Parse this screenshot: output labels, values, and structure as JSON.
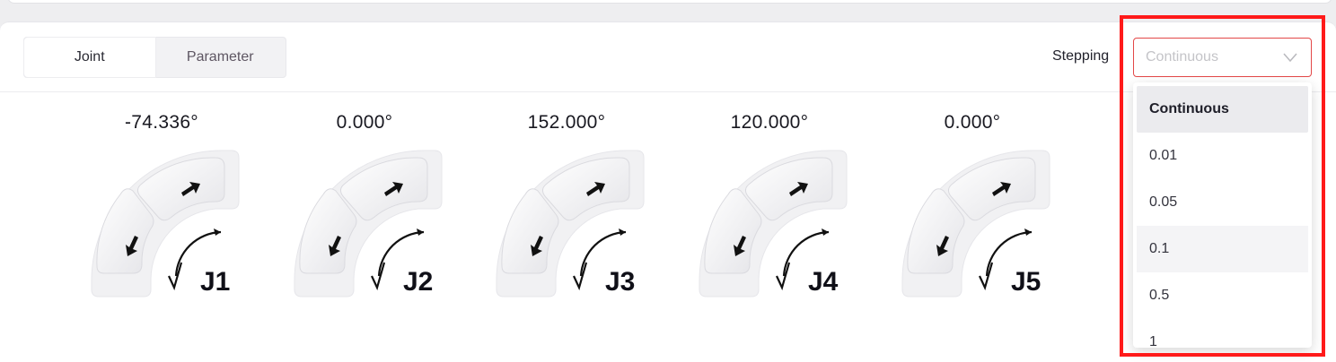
{
  "tabs": [
    {
      "label": "Joint",
      "active": true
    },
    {
      "label": "Parameter",
      "active": false
    }
  ],
  "stepping": {
    "label": "Stepping",
    "placeholder": "Continuous",
    "options": [
      "Continuous",
      "0.01",
      "0.05",
      "0.1",
      "0.5",
      "1"
    ],
    "selected": "Continuous",
    "hovered": "0.1"
  },
  "joints": [
    {
      "name": "J1",
      "angle": "-74.336°"
    },
    {
      "name": "J2",
      "angle": "0.000°"
    },
    {
      "name": "J3",
      "angle": "152.000°"
    },
    {
      "name": "J4",
      "angle": "120.000°"
    },
    {
      "name": "J5",
      "angle": "0.000°"
    }
  ],
  "colors": {
    "highlight": "#ff1a1a",
    "select_border": "#e34848"
  }
}
